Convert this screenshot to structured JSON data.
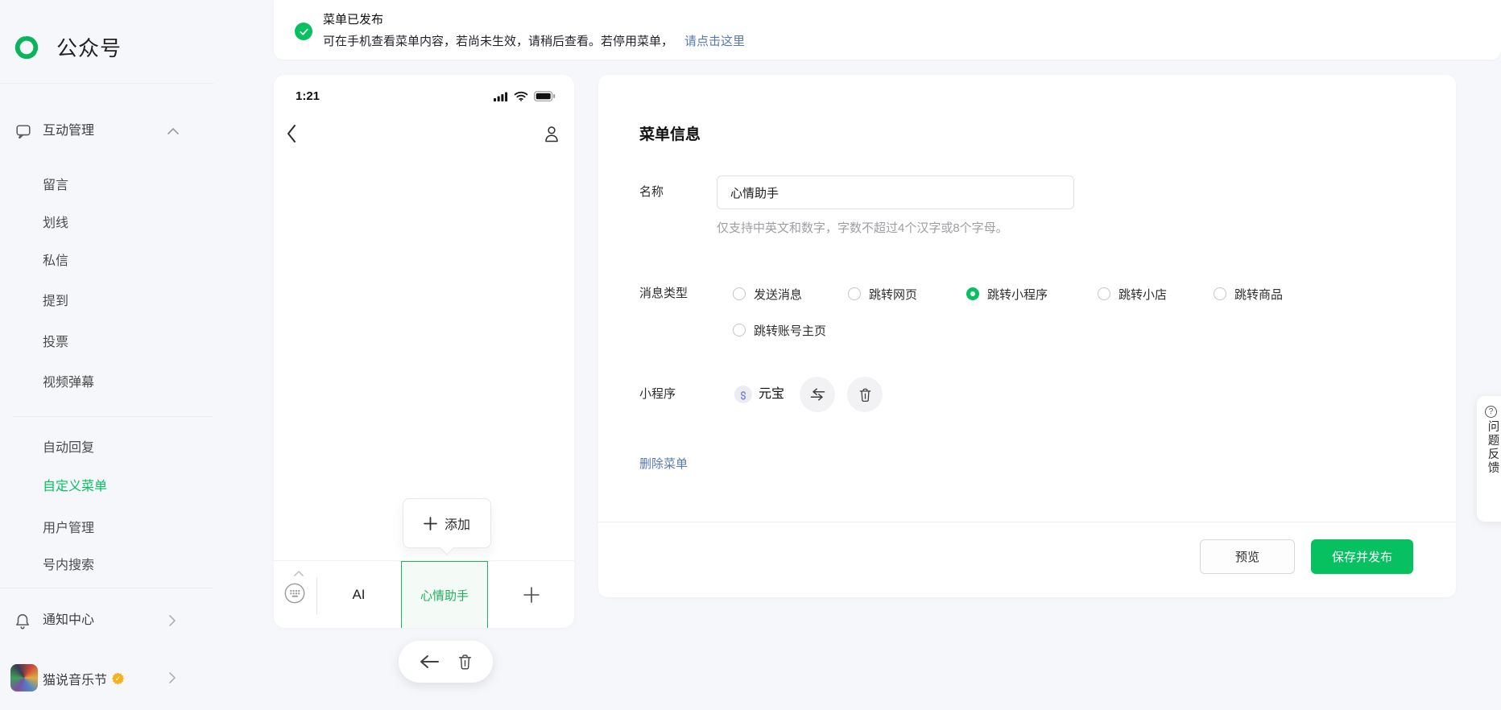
{
  "app": {
    "name": "公众号"
  },
  "notification": {
    "title": "菜单已发布",
    "body": "可在手机查看菜单内容，若尚未生效，请稍后查看。若停用菜单，",
    "link_label": "请点击这里"
  },
  "sidebar": {
    "group_label": "互动管理",
    "items": [
      "留言",
      "划线",
      "私信",
      "提到",
      "投票",
      "视频弹幕"
    ],
    "tools": [
      "自动回复",
      "自定义菜单",
      "用户管理",
      "号内搜索"
    ],
    "active_tool": "自定义菜单",
    "notice_label": "通知中心",
    "account_name": "猫说音乐节"
  },
  "phone": {
    "time": "1:21",
    "status_icons": [
      "signal-icon",
      "wifi-icon",
      "battery-icon"
    ],
    "add_label": "添加",
    "tab_ai": "AI",
    "tab_active": "心情助手"
  },
  "editor": {
    "title": "菜单信息",
    "name_label": "名称",
    "name_value": "心情助手",
    "name_hint": "仅支持中英文和数字，字数不超过4个汉字或8个字母。",
    "type_label": "消息类型",
    "options": [
      "发送消息",
      "跳转网页",
      "跳转小程序",
      "跳转小店",
      "跳转商品",
      "跳转账号主页"
    ],
    "selected_option": "跳转小程序",
    "mini_label": "小程序",
    "mini_value": "元宝",
    "delete_label": "删除菜单",
    "preview_label": "预览",
    "save_label": "保存并发布"
  },
  "feedback": {
    "chars": [
      "问",
      "题",
      "反",
      "馈"
    ]
  },
  "colors": {
    "brand_green": "#07c160",
    "link_blue": "#5778b3"
  }
}
